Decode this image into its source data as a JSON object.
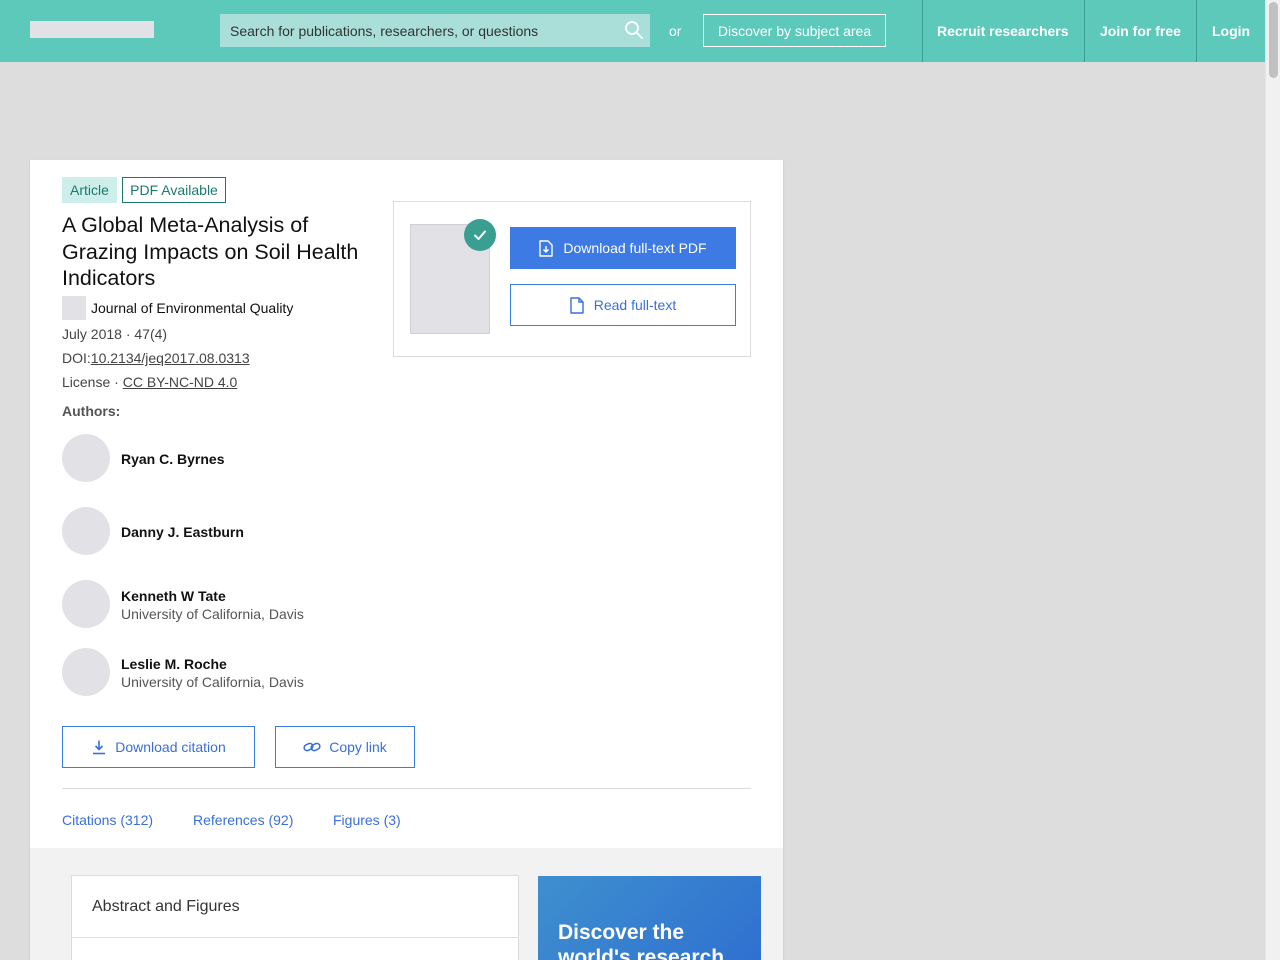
{
  "header": {
    "search_placeholder": "Search for publications, researchers, or questions",
    "or_text": "or",
    "discover_label": "Discover by subject area",
    "nav": [
      "Recruit researchers",
      "Join for free",
      "Login"
    ]
  },
  "article": {
    "badges": [
      "Article",
      "PDF Available"
    ],
    "title": "A Global Meta-Analysis of Grazing Impacts on Soil Health Indicators",
    "journal": "Journal of Environmental Quality",
    "date_issue": "July 2018 · 47(4)",
    "doi_label": "DOI:",
    "doi_value": "10.2134/jeq2017.08.0313",
    "license_label": "License · ",
    "license_value": "CC BY-NC-ND 4.0",
    "authors_label": "Authors:",
    "authors": [
      {
        "name": "Ryan C. Byrnes",
        "institution": ""
      },
      {
        "name": "Danny J. Eastburn",
        "institution": ""
      },
      {
        "name": "Kenneth W Tate",
        "institution": "University of California, Davis"
      },
      {
        "name": "Leslie M. Roche",
        "institution": "University of California, Davis"
      }
    ]
  },
  "pdf_box": {
    "download_label": "Download full-text PDF",
    "read_label": "Read full-text"
  },
  "actions": {
    "download_citation": "Download citation",
    "copy_link": "Copy link"
  },
  "tabs": [
    "Citations (312)",
    "References (92)",
    "Figures (3)"
  ],
  "lower": {
    "abstract_title": "Abstract and Figures",
    "promo_text": "Discover the world's research"
  },
  "colors": {
    "header_bg": "#5dc9ba",
    "accent_blue": "#3d7ae3",
    "teal_dark": "#1c7a6c"
  }
}
